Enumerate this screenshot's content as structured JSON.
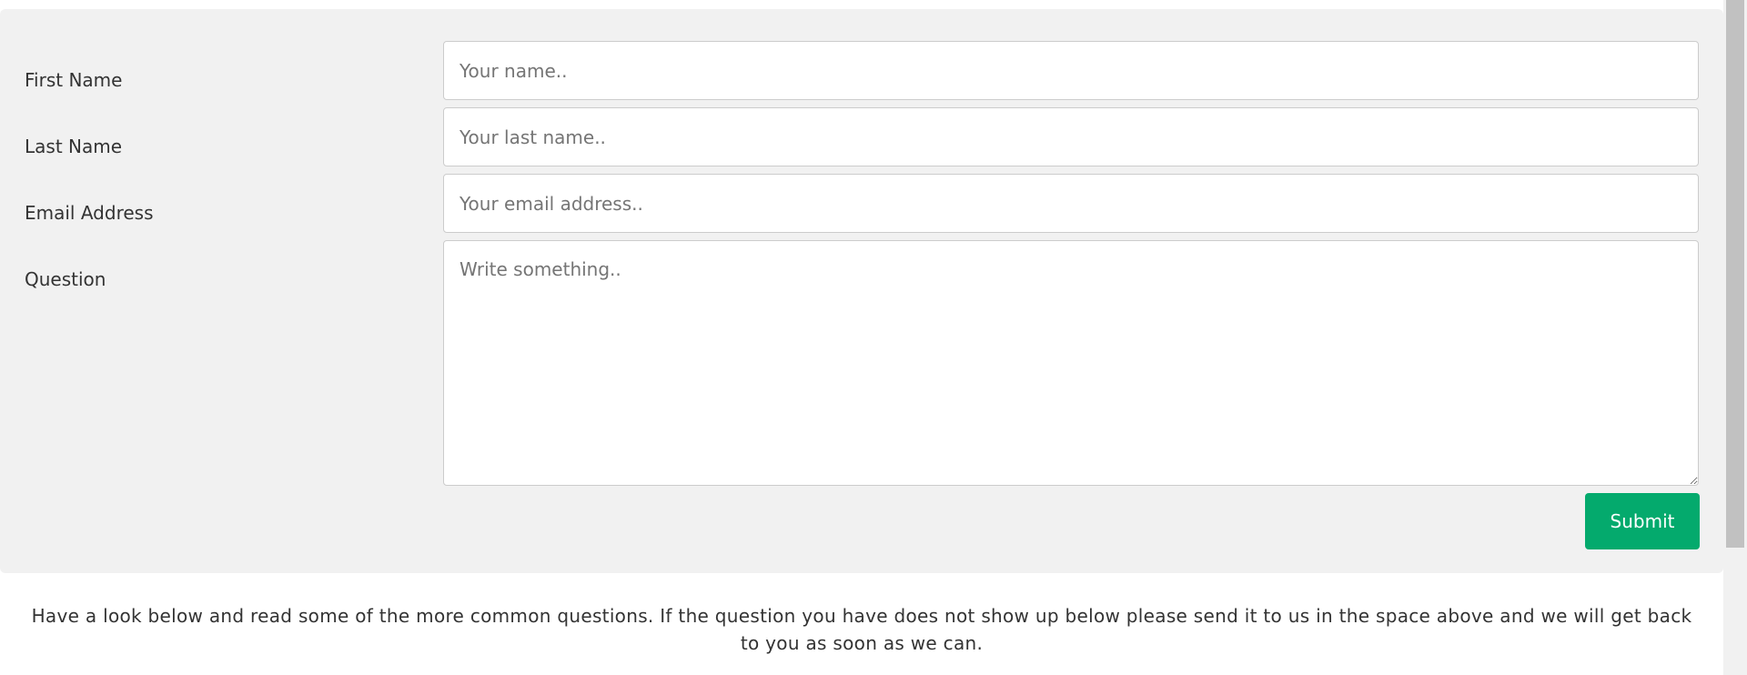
{
  "form": {
    "first_name": {
      "label": "First Name",
      "placeholder": "Your name..",
      "value": ""
    },
    "last_name": {
      "label": "Last Name",
      "placeholder": "Your last name..",
      "value": ""
    },
    "email": {
      "label": "Email Address",
      "placeholder": "Your email address..",
      "value": ""
    },
    "question": {
      "label": "Question",
      "placeholder": "Write something..",
      "value": ""
    },
    "submit_label": "Submit"
  },
  "intro": {
    "text": "Have a look below and read some of the more common questions. If the question you have does not show up below please send it to us in the space above and we will get back to you as soon as we can."
  },
  "colors": {
    "panel_background": "#f1f1f1",
    "submit_background": "#04aa6d",
    "submit_text": "#ffffff"
  }
}
